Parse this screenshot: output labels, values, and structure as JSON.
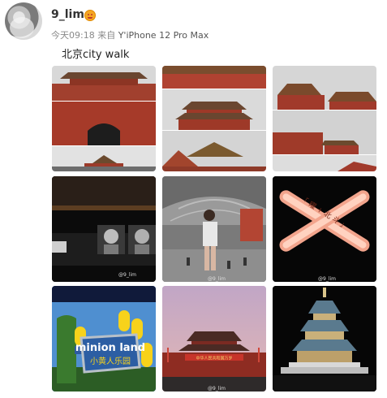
{
  "user": {
    "name": "9_lim"
  },
  "post": {
    "time": "今天09:18",
    "source_prefix": "来自",
    "source": "Y'iPhone 12 Pro Max",
    "text": "北京city walk"
  },
  "photos": {
    "count": 9,
    "watermark": "@9_lim",
    "glow_stick_text": "「 曜 + 北 斗 」",
    "minion_sign_title": "minion land",
    "minion_sign_subtitle": "小黄人乐园",
    "tiananmen_banner": "中华人民共和国万岁"
  },
  "icons": {
    "badge": "vip-badge-icon",
    "location": "location-pin-icon"
  },
  "colors": {
    "username": "#333333",
    "meta": "#8a8a8a",
    "palace_red": "#a73a2a"
  }
}
